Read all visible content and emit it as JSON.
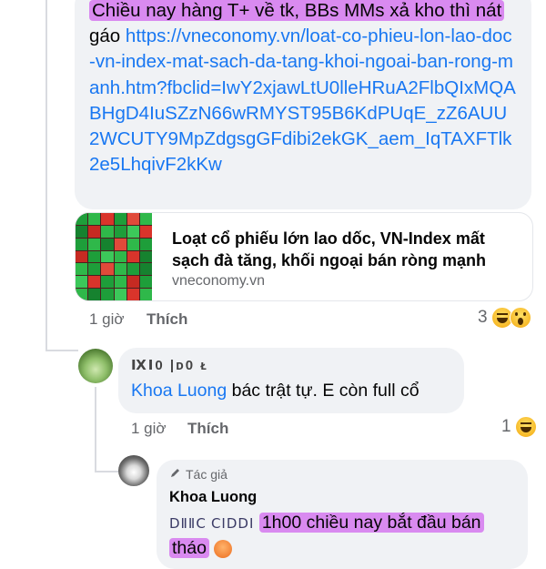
{
  "comment1": {
    "highlighted": "Chiều nay hàng T+ về tk, BBs MMs xả kho thì nát",
    "tail": "gáo",
    "link": "https://vneconomy.vn/loat-co-phieu-lon-lao-doc-vn-index-mat-sach-da-tang-khoi-ngoai-ban-rong-manh.htm?fbclid=IwY2xjawLtU0lleHRuA2FlbQIxMQABHgD4IuSZzN66wRMYST95B6KdPUqE_zZ6AUU2WCUTY9MpZdgsgGFdibi2ekGK_aem_IqTAXFTlk2e5LhqivF2kKw",
    "preview_title": "Loạt cổ phiếu lớn lao dốc, VN-Index mất sạch đà tăng, khối ngoại bán ròng mạnh",
    "preview_domain": "vneconomy.vn",
    "time": "1 giờ",
    "like_label": "Thích",
    "reaction_count": "3"
  },
  "reply1": {
    "author": "ⅨⅠ0 |ᴅ0 ᴌ",
    "mention": "Khoa Luong",
    "text": " bác trật tự. E còn full cổ",
    "time": "1 giờ",
    "like_label": "Thích",
    "reaction_count": "1"
  },
  "reply2": {
    "badge": "Tác giả",
    "author": "Khoa Luong",
    "mention_obscured": "ⅮⅡⅡⅭ ⅭⅠⅮⅮⅠ",
    "text_highlighted": "1h00 chiều nay bắt đầu bán",
    "text_line2": "tháo"
  },
  "colors": {
    "link": "#1877f2",
    "highlight": "#d98af0",
    "bubble": "#f0f2f5",
    "muted": "#65676b"
  }
}
